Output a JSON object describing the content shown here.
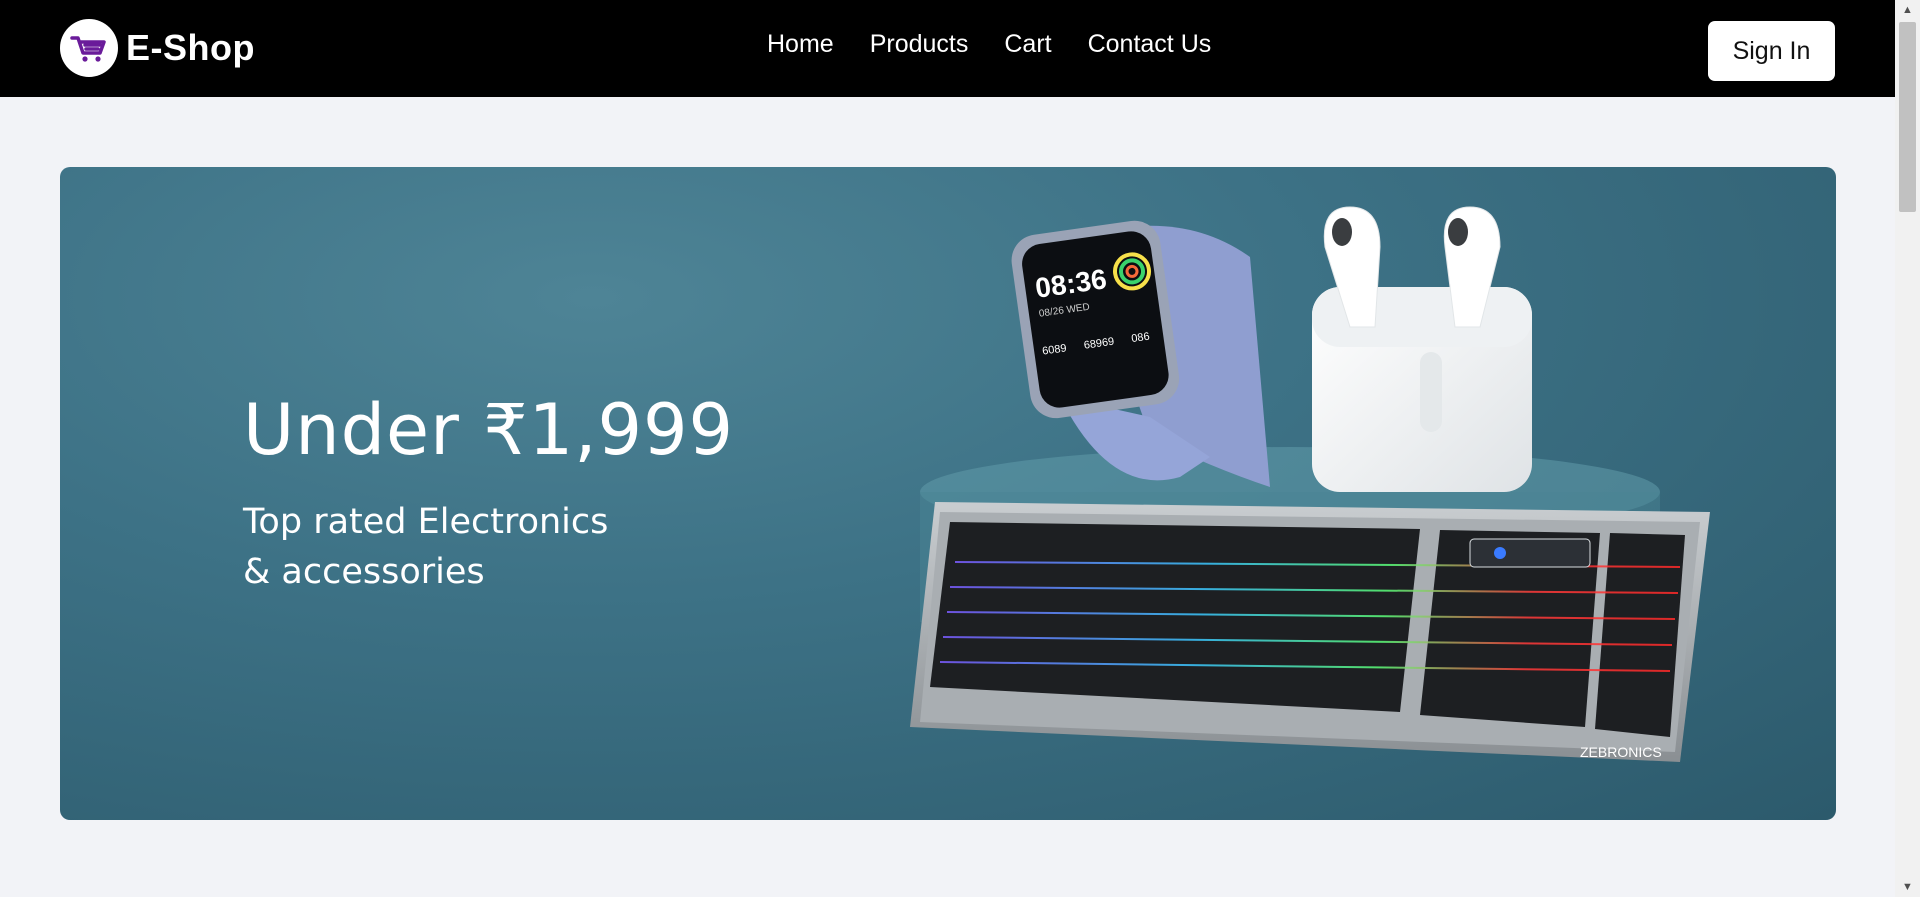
{
  "brand": {
    "name": "E-Shop",
    "logo_icon": "shopping-cart-icon",
    "accent": "#7b1fa2"
  },
  "nav": {
    "links": [
      "Home",
      "Products",
      "Cart",
      "Contact Us"
    ]
  },
  "auth": {
    "signin_label": "Sign In"
  },
  "hero": {
    "title": "Under ₹1,999",
    "subtitle_line1": "Top rated Electronics",
    "subtitle_line2": "& accessories",
    "watch": {
      "time": "08:36",
      "date": "08/26 WED",
      "stat1": "6089",
      "stat2": "68969",
      "stat3": "086"
    },
    "keyboard_brand": "ZEBRONICS",
    "products_shown": [
      "smartwatch",
      "wireless-earbuds",
      "gaming-keyboard"
    ]
  },
  "colors": {
    "nav_bg": "#000000",
    "page_bg": "#f2f3f7",
    "hero_bg": "#3d7286",
    "text_light": "#ffffff"
  }
}
